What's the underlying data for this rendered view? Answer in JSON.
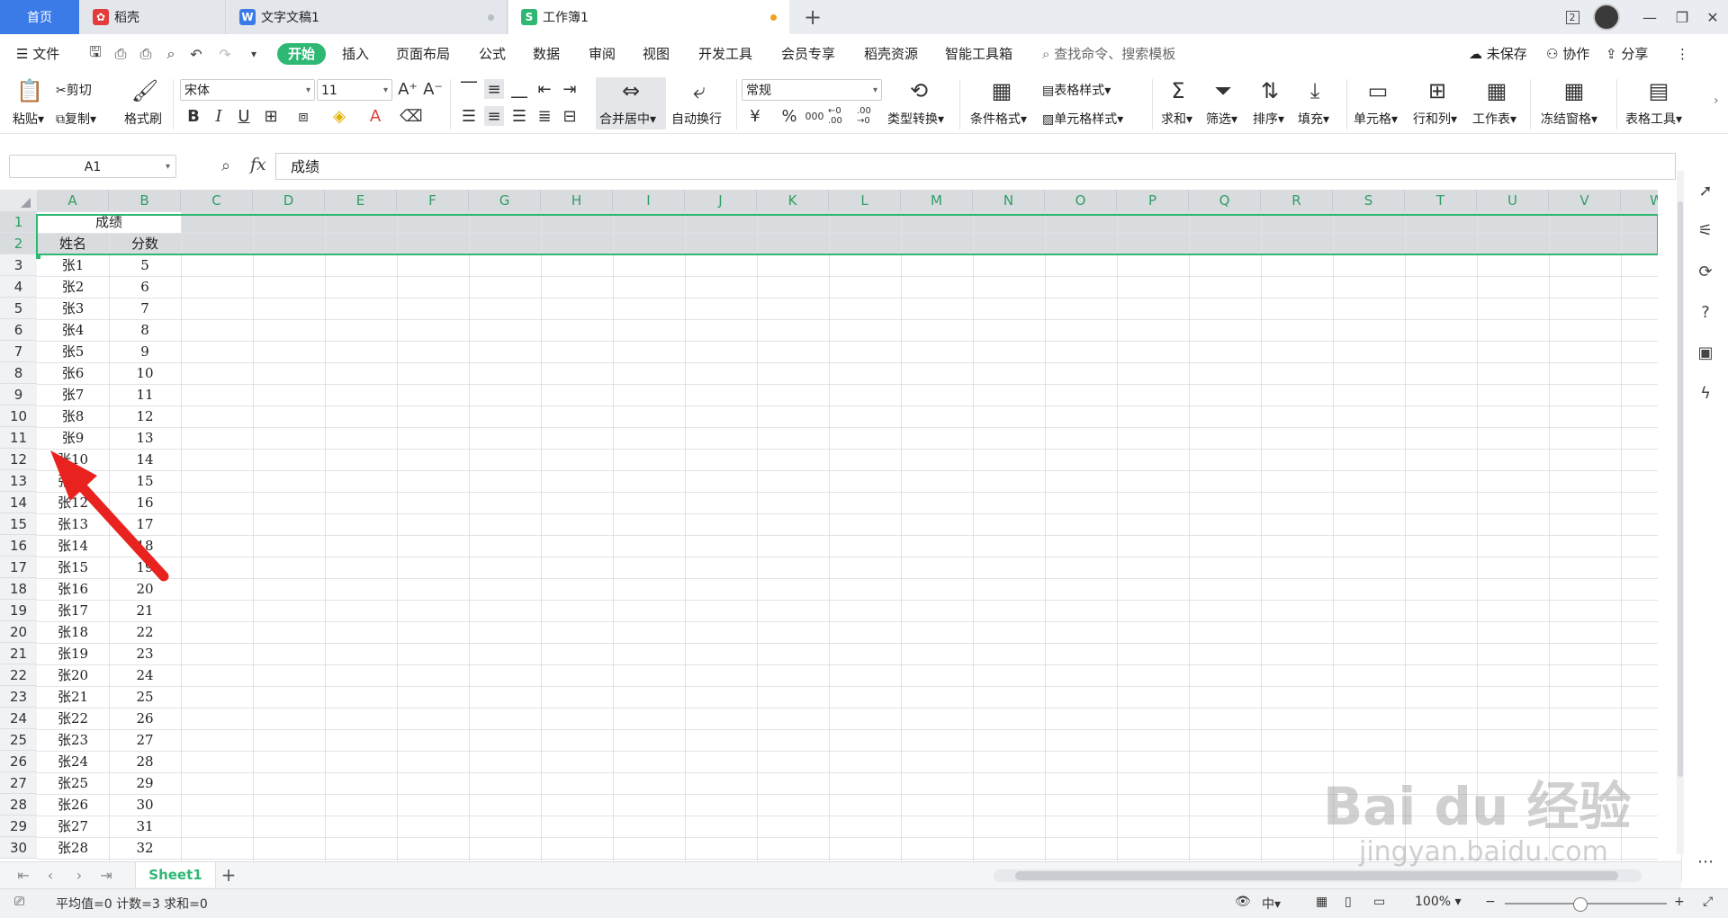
{
  "tabs": {
    "home": "首页",
    "docer": "稻壳",
    "doc": "文字文稿1",
    "workbook": "工作簿1",
    "docer_icon": "docer-icon",
    "writer_icon": "W",
    "sheet_icon": "S",
    "unsaved_dot_color": "#f0a020",
    "badge": "2"
  },
  "menu": {
    "file": "文件",
    "items": [
      "开始",
      "插入",
      "页面布局",
      "公式",
      "数据",
      "审阅",
      "视图",
      "开发工具",
      "会员专享",
      "稻壳资源",
      "智能工具箱"
    ],
    "search": "查找命令、搜索模板",
    "unsaved": "未保存",
    "collab": "协作",
    "share": "分享"
  },
  "ribbon": {
    "paste": "粘贴",
    "cut": "剪切",
    "copy": "复制",
    "format_painter": "格式刷",
    "font_name": "宋体",
    "font_size": "11",
    "merge_center": "合并居中",
    "wrap_text": "自动换行",
    "number_format": "常规",
    "type_convert": "类型转换",
    "cond_format": "条件格式",
    "table_style": "表格样式",
    "cell_style": "单元格样式",
    "sum": "求和",
    "filter": "筛选",
    "sort": "排序",
    "fill": "填充",
    "cells": "单元格",
    "rows_cols": "行和列",
    "worksheet": "工作表",
    "freeze": "冻结窗格",
    "table_tools": "表格工具",
    "currency": "¥",
    "percent": "%",
    "thousands": "000",
    "inc_decimal": "←0 .00",
    "dec_decimal": ".00 →0"
  },
  "formula": {
    "cell_ref": "A1",
    "fx": "fx",
    "value": "成绩"
  },
  "grid": {
    "columns": [
      "A",
      "B",
      "C",
      "D",
      "E",
      "F",
      "G",
      "H",
      "I",
      "J",
      "K",
      "L",
      "M",
      "N",
      "O",
      "P",
      "Q",
      "R",
      "S",
      "T",
      "U",
      "V",
      "W"
    ],
    "row_numbers": [
      "1",
      "2",
      "3",
      "4",
      "5",
      "6",
      "7",
      "8",
      "9",
      "10",
      "11",
      "12",
      "13",
      "14",
      "15",
      "16",
      "17",
      "18",
      "19",
      "20",
      "21",
      "22",
      "23",
      "24",
      "25",
      "26",
      "27",
      "28",
      "29",
      "30"
    ],
    "title": "成绩",
    "header_name": "姓名",
    "header_score": "分数",
    "names": [
      "张1",
      "张2",
      "张3",
      "张4",
      "张5",
      "张6",
      "张7",
      "张8",
      "张9",
      "张10",
      "张11",
      "张12",
      "张13",
      "张14",
      "张15",
      "张16",
      "张17",
      "张18",
      "张19",
      "张20",
      "张21",
      "张22",
      "张23",
      "张24",
      "张25",
      "张26",
      "张27",
      "张28"
    ],
    "scores": [
      "5",
      "6",
      "7",
      "8",
      "9",
      "10",
      "11",
      "12",
      "13",
      "14",
      "15",
      "16",
      "17",
      "18",
      "19",
      "20",
      "21",
      "22",
      "23",
      "24",
      "25",
      "26",
      "27",
      "28",
      "29",
      "30",
      "31",
      "32"
    ],
    "selection_color": "#2eb873",
    "frozen_fill": "#d9dcdf"
  },
  "sheetbar": {
    "sheet": "Sheet1",
    "add": "+"
  },
  "status": {
    "stats": "平均值=0  计数=3  求和=0",
    "zoom": "100%"
  },
  "annotation": {
    "arrow_color": "#e8231f"
  },
  "watermark": {
    "brand": "Bai du 经验",
    "url": "jingyan.baidu.com"
  }
}
